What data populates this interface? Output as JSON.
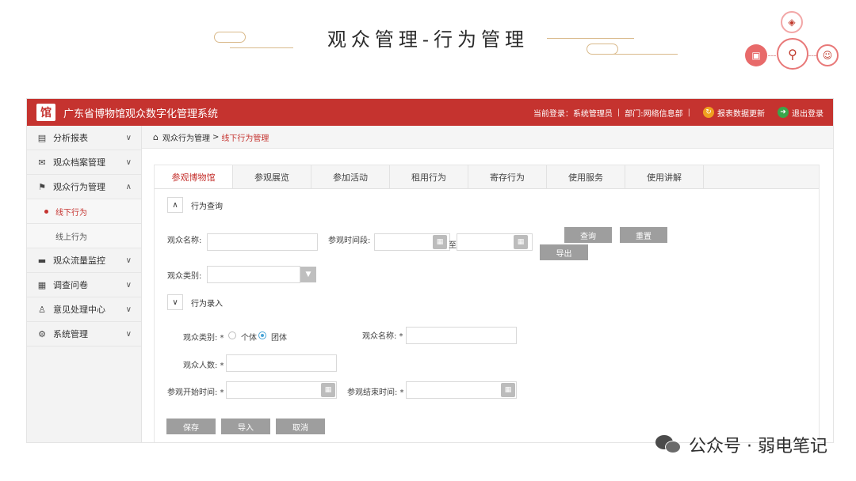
{
  "slide": {
    "title": "观众管理-行为管理"
  },
  "app": {
    "logo_text": "馆",
    "title": "广东省博物馆观众数字化管理系统",
    "login_info": "当前登录：系统管理员",
    "department": "部门:网络信息部",
    "update_btn": "报表数据更新",
    "logout_btn": "退出登录"
  },
  "sidebar": {
    "items": [
      {
        "label": "分析报表",
        "icon": "report-search-icon"
      },
      {
        "label": "观众档案管理",
        "icon": "envelope-icon"
      },
      {
        "label": "观众行为管理",
        "icon": "flag-icon"
      },
      {
        "label": "观众流量监控",
        "icon": "monitor-icon"
      },
      {
        "label": "调查问卷",
        "icon": "document-icon"
      },
      {
        "label": "意见处理中心",
        "icon": "person-icon"
      },
      {
        "label": "系统管理",
        "icon": "gear-icon"
      }
    ],
    "subitems": [
      "线下行为",
      "线上行为"
    ]
  },
  "breadcrumb": {
    "root": "观众行为管理",
    "sep": ">",
    "current": "线下行为管理"
  },
  "tabs": [
    "参观博物馆",
    "参观展览",
    "参加活动",
    "租用行为",
    "寄存行为",
    "使用服务",
    "使用讲解"
  ],
  "query": {
    "section_title": "行为查询",
    "name_label": "观众名称:",
    "name_value": "",
    "period_label": "参观时间段:",
    "to_label": "至",
    "type_label": "观众类别:",
    "search_btn": "查询",
    "reset_btn": "重置",
    "export_btn": "导出"
  },
  "entry": {
    "section_title": "行为录入",
    "type_label": "观众类别: *",
    "radio_individual": "个体",
    "radio_group": "团体",
    "name_label": "观众名称: *",
    "count_label": "观众人数: *",
    "start_label": "参观开始时间: *",
    "end_label": "参观结束时间: *",
    "save_btn": "保存",
    "import_btn": "导入",
    "cancel_btn": "取消"
  },
  "watermark": {
    "text": "公众号 · 弱电笔记"
  }
}
